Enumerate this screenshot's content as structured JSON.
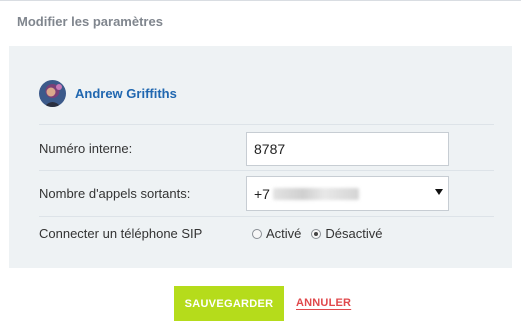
{
  "dialog": {
    "title": "Modifier les paramètres"
  },
  "user": {
    "name": "Andrew Griffiths"
  },
  "fields": {
    "internal_number": {
      "label": "Numéro interne:",
      "value": "8787"
    },
    "outgoing_calls": {
      "label": "Nombre d'appels sortants:",
      "value_prefix": "+7"
    },
    "sip_phone": {
      "label": "Connecter un téléphone SIP",
      "options": [
        "Activé",
        "Désactivé"
      ],
      "selected": "Désactivé"
    }
  },
  "actions": {
    "save_label": "SAUVEGARDER",
    "cancel_label": "ANNULER"
  },
  "colors": {
    "save_button": "#b5dc1b",
    "cancel_link": "#e0494c",
    "user_name": "#2067b0",
    "panel_bg": "#eef2f4"
  }
}
